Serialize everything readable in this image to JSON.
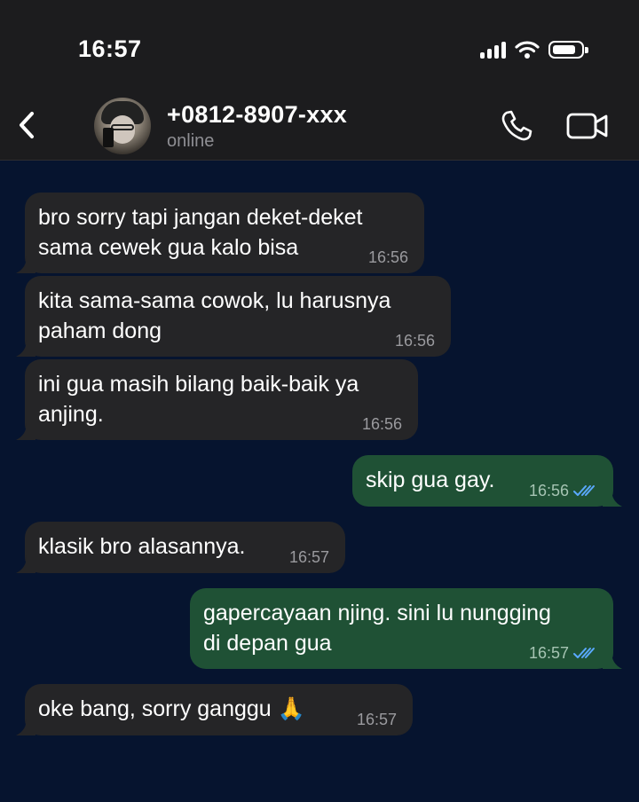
{
  "status_bar": {
    "time": "16:57"
  },
  "header": {
    "back_icon": "chevron-left-icon",
    "contact_name": "+0812-8907-xxx",
    "contact_status": "online",
    "call_icon": "phone-icon",
    "video_icon": "video-camera-icon"
  },
  "colors": {
    "chat_background": "#06142f",
    "incoming_bubble": "#252527",
    "outgoing_bubble": "#1f5135",
    "read_ticks": "#5aa9ff"
  },
  "messages": [
    {
      "direction": "in",
      "text_lines": [
        "bro sorry tapi jangan deket-deket",
        "sama cewek gua kalo bisa"
      ],
      "time": "16:56"
    },
    {
      "direction": "in",
      "text_lines": [
        "kita sama-sama cowok, lu harusnya",
        "paham dong"
      ],
      "time": "16:56"
    },
    {
      "direction": "in",
      "text_lines": [
        "ini gua masih bilang baik-baik ya",
        "anjing."
      ],
      "time": "16:56"
    },
    {
      "direction": "out",
      "text_lines": [
        "skip gua gay."
      ],
      "time": "16:56",
      "status": "read"
    },
    {
      "direction": "in",
      "text_lines": [
        "klasik bro alasannya."
      ],
      "time": "16:57"
    },
    {
      "direction": "out",
      "text_lines": [
        "gapercayaan njing. sini lu nungging",
        "di depan gua"
      ],
      "time": "16:57",
      "status": "read"
    },
    {
      "direction": "in",
      "text_lines": [
        "oke bang, sorry ganggu 🙏"
      ],
      "time": "16:57"
    }
  ]
}
